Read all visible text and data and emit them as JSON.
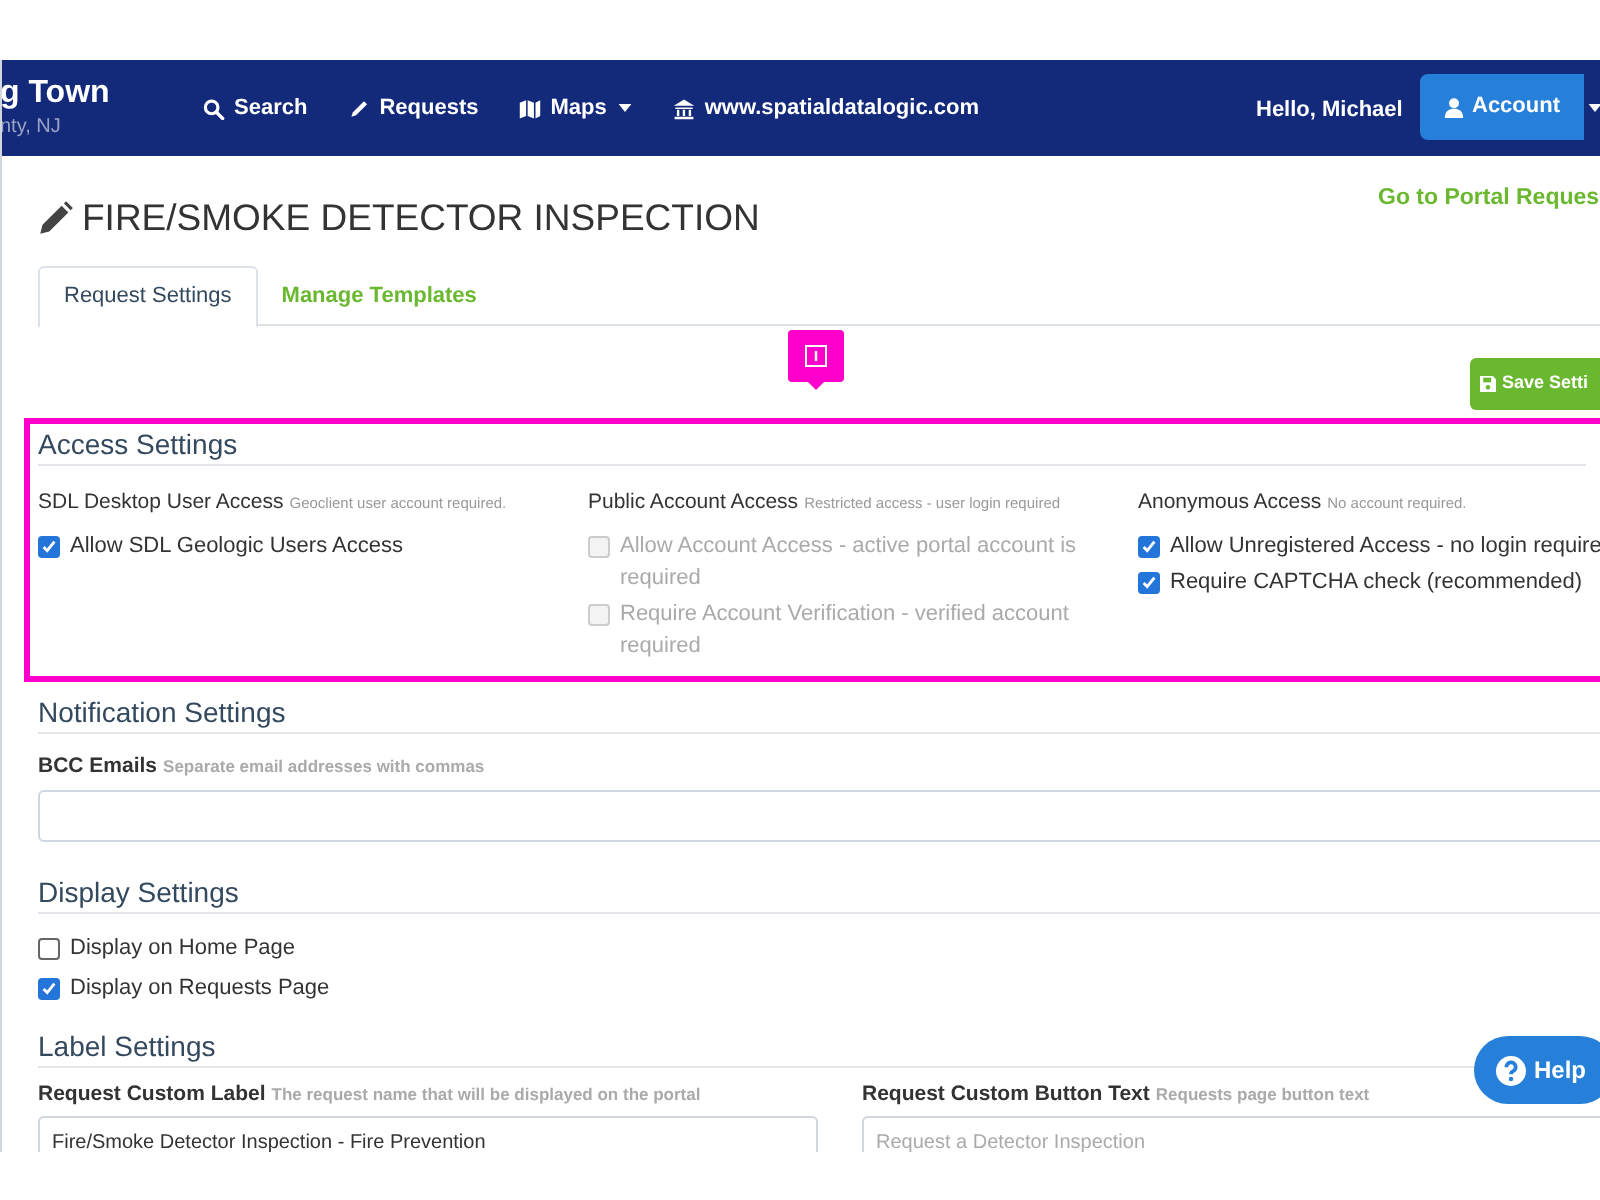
{
  "navbar": {
    "brand_title": "g Town",
    "brand_subtitle": "nty, NJ",
    "links": [
      {
        "label": "Search",
        "kind": "search",
        "dropdown": false
      },
      {
        "label": "Requests",
        "kind": "pencil",
        "dropdown": false
      },
      {
        "label": "Maps",
        "kind": "map",
        "dropdown": true
      },
      {
        "label": "www.spatialdatalogic.com",
        "kind": "bank",
        "dropdown": false
      }
    ],
    "greeting": "Hello, Michael",
    "account_button": "Account"
  },
  "page": {
    "title": "FIRE/SMOKE DETECTOR INSPECTION",
    "portal_link": "Go to Portal Reques",
    "tabs": [
      {
        "label": "Request Settings",
        "selected": true
      },
      {
        "label": "Manage Templates",
        "selected": false
      }
    ],
    "save_button": "Save Setti"
  },
  "access_settings": {
    "heading": "Access Settings",
    "groups": [
      {
        "title": "SDL Desktop User Access",
        "hint": "Geoclient user account required.",
        "options": [
          {
            "label": "Allow SDL Geologic Users Access",
            "checked": true,
            "disabled": false
          }
        ]
      },
      {
        "title": "Public Account Access",
        "hint": "Restricted access - user login required",
        "options": [
          {
            "label": "Allow Account Access - active portal account is required",
            "checked": false,
            "disabled": true
          },
          {
            "label": "Require Account Verification - verified account required",
            "checked": false,
            "disabled": true
          }
        ]
      },
      {
        "title": "Anonymous Access",
        "hint": "No account required.",
        "options": [
          {
            "label": "Allow Unregistered Access - no login require",
            "checked": true,
            "disabled": false
          },
          {
            "label": "Require CAPTCHA check (recommended)",
            "checked": true,
            "disabled": false
          }
        ]
      }
    ]
  },
  "notification_settings": {
    "heading": "Notification Settings",
    "field": {
      "label": "BCC Emails",
      "hint": "Separate email addresses with commas"
    }
  },
  "display_settings": {
    "heading": "Display Settings",
    "options": [
      {
        "label": "Display on Home Page",
        "checked": false
      },
      {
        "label": "Display on Requests Page",
        "checked": true
      }
    ]
  },
  "label_settings": {
    "heading": "Label Settings",
    "fields": [
      {
        "label": "Request Custom Label",
        "hint": "The request name that will be displayed on the portal",
        "value": "Fire/Smoke Detector Inspection - Fire Prevention"
      },
      {
        "label": "Request Custom Button Text",
        "hint": "Requests page button text",
        "placeholder": "Request a Detector Inspection"
      }
    ]
  },
  "help_button": "Help"
}
